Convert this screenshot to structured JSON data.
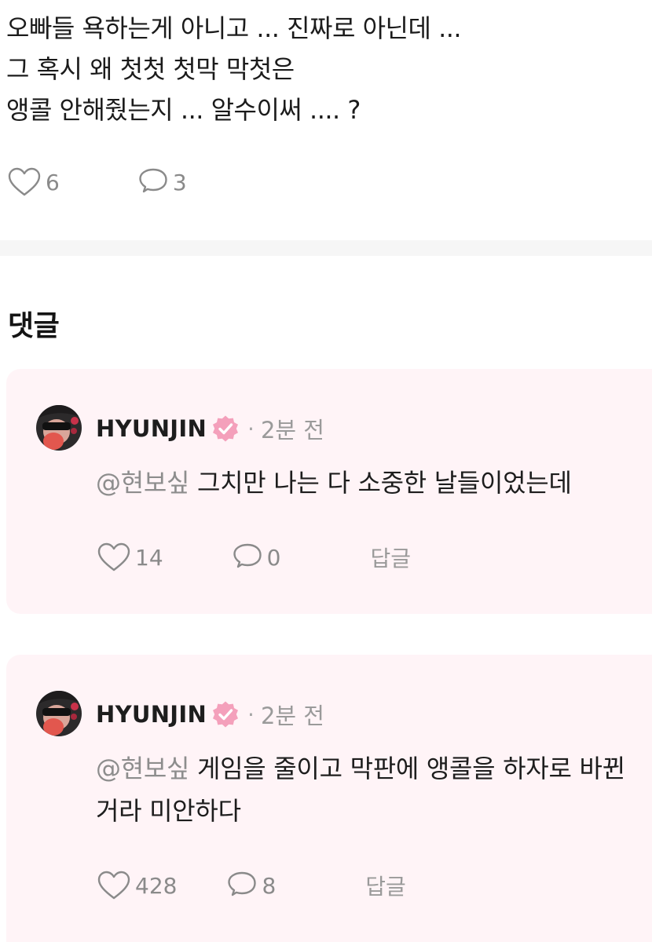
{
  "post": {
    "lines": [
      "오빠들 욕하는게 아니고 ... 진짜로 아닌데 ...",
      "그 혹시 왜 첫첫 첫막 막첫은",
      "앵콜 안해줬는지 ... 알수이써 .... ?"
    ],
    "like_count": "6",
    "comment_count": "3"
  },
  "comments_section": {
    "title": "댓글",
    "comments": [
      {
        "author": "HYUNJIN",
        "separator": "·",
        "time": "2분 전",
        "mention": "@현보싶",
        "text": "그치만 나는 다 소중한 날들이었는데",
        "likes": "14",
        "replies": "0",
        "reply_label": "답글"
      },
      {
        "author": "HYUNJIN",
        "separator": "·",
        "time": "2분 전",
        "mention": "@현보싶",
        "text": "게임을 줄이고 막판에 앵콜을 하자로 바뀐거라 미안하다",
        "likes": "428",
        "replies": "8",
        "reply_label": "답글"
      }
    ]
  },
  "icons": {
    "like": "heart-outline-icon",
    "comment": "speech-bubble-icon",
    "verified": "verified-badge-icon"
  },
  "colors": {
    "comment_background": "#fff4f7",
    "verified_badge": "#f4a0bb",
    "muted_text": "#8a8a8a"
  }
}
